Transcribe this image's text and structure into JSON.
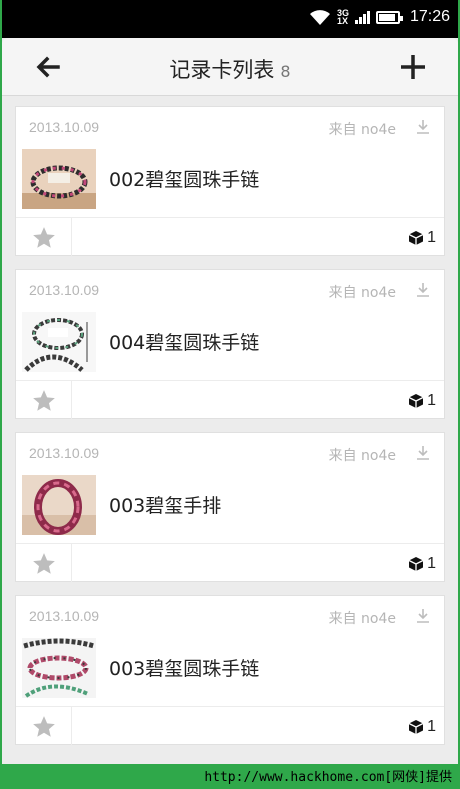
{
  "status_bar": {
    "network": "3G\n1X",
    "time": "17:26"
  },
  "header": {
    "title": "记录卡列表",
    "count": "8"
  },
  "cards": [
    {
      "date": "2013.10.09",
      "source": "来自 no4e",
      "title": "002碧玺圆珠手链",
      "cube_count": "1",
      "thumb_icon": "bracelet-photo"
    },
    {
      "date": "2013.10.09",
      "source": "来自 no4e",
      "title": "004碧玺圆珠手链",
      "cube_count": "1",
      "thumb_icon": "bracelet-photo"
    },
    {
      "date": "2013.10.09",
      "source": "来自 no4e",
      "title": "003碧玺手排",
      "cube_count": "1",
      "thumb_icon": "bangle-photo"
    },
    {
      "date": "2013.10.09",
      "source": "来自 no4e",
      "title": "003碧玺圆珠手链",
      "cube_count": "1",
      "thumb_icon": "bracelet-photo"
    }
  ],
  "watermark": "http://www.hackhome.com[网侠]提供",
  "colors": {
    "accent_green": "#2fa84a",
    "star": "#bdbdbd",
    "meta_text": "#b5b5b5"
  }
}
